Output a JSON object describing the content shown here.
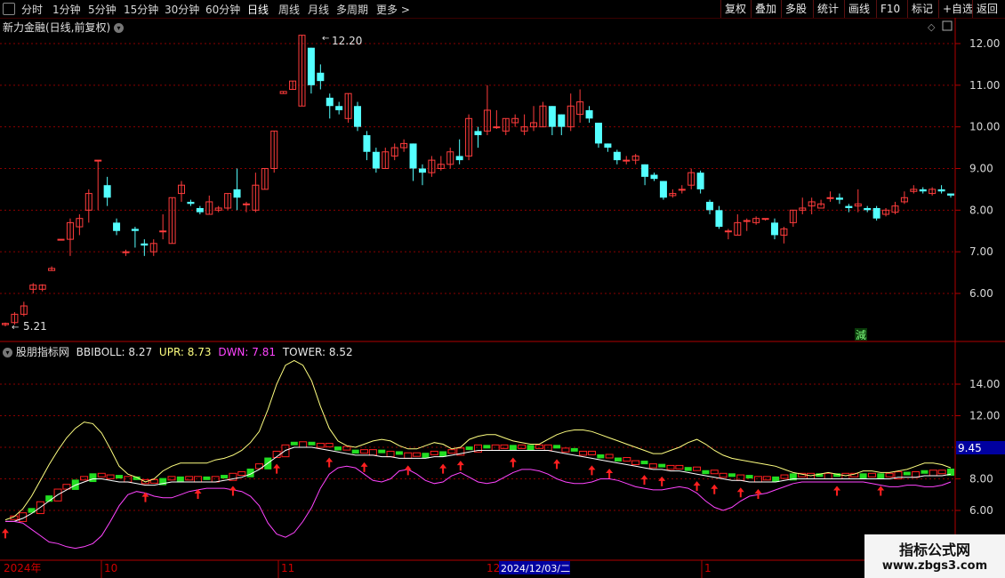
{
  "toolbar": {
    "periods": [
      "分时",
      "1分钟",
      "5分钟",
      "15分钟",
      "30分钟",
      "60分钟",
      "日线",
      "周线",
      "月线",
      "多周期",
      "更多 >"
    ],
    "active_period": "日线",
    "right_buttons": [
      "复权",
      "叠加",
      "多股",
      "统计",
      "画线",
      "F10",
      "标记",
      "+自选",
      "返回"
    ]
  },
  "chart_title": "新力金融(日线,前复权)",
  "price_axis_labels": [
    "12.00",
    "11.00",
    "10.00",
    "9.00",
    "8.00",
    "7.00",
    "6.00"
  ],
  "indicator": {
    "name": "股朋指标网",
    "bbiboll_label": "BBIBOLL: 8.27",
    "upr_label": "UPR: 8.73",
    "dwn_label": "DWN: 7.81",
    "tower_label": "TOWER: 8.52",
    "axis_labels": [
      "14.00",
      "12.00",
      "10.00",
      "8.00",
      "6.00"
    ],
    "current_value": "9.45"
  },
  "annotations": {
    "high": "12.20",
    "low": "5.21",
    "reduce_marker": "減"
  },
  "date_axis": {
    "labels": [
      "2024年",
      "10",
      "11",
      "12",
      "1"
    ],
    "cursor_date": "2024/12/03/二"
  },
  "watermark": {
    "line1": "指标公式网",
    "line2": "www.zbgs3.com"
  },
  "colors": {
    "up": "#ff3c3c",
    "down": "#54ffff",
    "upr_line": "#ffff80",
    "dwn_line": "#ff44ff",
    "mid_line": "#ffffff",
    "grid": "#8a0000",
    "bar_green": "#22dd22",
    "arrow": "#ff2020"
  },
  "chart_data": [
    {
      "type": "candlestick",
      "title": "新力金融(日线,前复权)",
      "ylim": [
        5.2,
        12.3
      ],
      "y_ticks": [
        12,
        11,
        10,
        9,
        8,
        7,
        6
      ],
      "x_labels": [
        "2024年",
        "10",
        "11",
        "12",
        "1"
      ],
      "candles": [
        [
          5.25,
          5.28,
          5.21,
          5.3
        ],
        [
          5.3,
          5.5,
          5.25,
          5.55
        ],
        [
          5.5,
          5.7,
          5.45,
          5.8
        ],
        [
          6.1,
          6.2,
          6.0,
          6.25
        ],
        [
          6.1,
          6.2,
          6.05,
          6.22
        ],
        [
          6.55,
          6.6,
          6.55,
          6.65
        ],
        [
          7.3,
          7.3,
          7.28,
          7.3
        ],
        [
          7.3,
          7.7,
          6.9,
          7.8
        ],
        [
          7.6,
          7.8,
          7.4,
          7.9
        ],
        [
          8.0,
          8.4,
          7.7,
          8.5
        ],
        [
          9.2,
          9.2,
          8.0,
          9.2
        ],
        [
          8.6,
          8.3,
          8.1,
          8.8
        ],
        [
          7.7,
          7.5,
          7.4,
          7.8
        ],
        [
          7.0,
          7.0,
          6.9,
          7.05
        ],
        [
          7.55,
          7.5,
          7.1,
          7.6
        ],
        [
          7.2,
          7.15,
          6.9,
          7.3
        ],
        [
          7.0,
          7.2,
          6.9,
          7.3
        ],
        [
          7.5,
          7.5,
          7.3,
          7.9
        ],
        [
          7.2,
          8.3,
          7.2,
          8.3
        ],
        [
          8.4,
          8.6,
          8.2,
          8.7
        ],
        [
          8.2,
          8.15,
          8.1,
          8.25
        ],
        [
          8.05,
          7.95,
          7.9,
          8.1
        ],
        [
          7.9,
          8.2,
          7.9,
          8.35
        ],
        [
          8.0,
          8.05,
          7.95,
          8.1
        ],
        [
          8.05,
          8.4,
          8.0,
          8.4
        ],
        [
          8.5,
          8.3,
          8.0,
          9.0
        ],
        [
          8.15,
          8.15,
          7.95,
          8.2
        ],
        [
          8.0,
          8.6,
          7.95,
          8.9
        ],
        [
          8.5,
          9.0,
          8.5,
          9.0
        ],
        [
          9.0,
          9.9,
          8.9,
          9.9
        ],
        [
          10.8,
          10.85,
          10.8,
          10.85
        ],
        [
          10.9,
          11.1,
          10.9,
          11.1
        ],
        [
          10.5,
          12.2,
          10.5,
          12.2
        ],
        [
          11.9,
          11.0,
          10.8,
          11.9
        ],
        [
          11.3,
          11.1,
          10.9,
          11.5
        ],
        [
          10.7,
          10.5,
          10.2,
          10.8
        ],
        [
          10.5,
          10.4,
          10.3,
          10.6
        ],
        [
          10.2,
          10.8,
          10.1,
          10.8
        ],
        [
          10.5,
          10.0,
          9.9,
          10.6
        ],
        [
          9.8,
          9.4,
          9.2,
          9.9
        ],
        [
          9.4,
          9.0,
          8.9,
          9.5
        ],
        [
          9.0,
          9.4,
          9.0,
          9.5
        ],
        [
          9.3,
          9.5,
          9.2,
          9.6
        ],
        [
          9.5,
          9.6,
          9.4,
          9.7
        ],
        [
          9.6,
          9.0,
          8.7,
          9.6
        ],
        [
          9.0,
          8.9,
          8.6,
          9.1
        ],
        [
          8.9,
          9.2,
          8.8,
          9.3
        ],
        [
          9.0,
          9.1,
          8.95,
          9.3
        ],
        [
          9.1,
          9.4,
          9.0,
          9.5
        ],
        [
          9.3,
          9.2,
          9.1,
          9.7
        ],
        [
          9.3,
          10.2,
          9.2,
          10.3
        ],
        [
          9.9,
          9.8,
          9.5,
          10.0
        ],
        [
          9.9,
          10.4,
          9.8,
          11.0
        ],
        [
          10.0,
          10.0,
          9.95,
          10.4
        ],
        [
          9.9,
          10.2,
          9.8,
          10.2
        ],
        [
          10.1,
          10.2,
          10.0,
          10.3
        ],
        [
          9.9,
          10.0,
          9.8,
          10.3
        ],
        [
          10.0,
          10.1,
          9.9,
          10.5
        ],
        [
          10.0,
          10.5,
          10.0,
          10.6
        ],
        [
          10.5,
          10.0,
          9.8,
          10.5
        ],
        [
          10.3,
          10.0,
          9.8,
          10.3
        ],
        [
          10.0,
          10.5,
          9.9,
          10.8
        ],
        [
          10.3,
          10.6,
          10.1,
          10.9
        ],
        [
          10.4,
          10.2,
          10.1,
          10.5
        ],
        [
          10.1,
          9.6,
          9.5,
          10.1
        ],
        [
          9.6,
          9.5,
          9.4,
          9.6
        ],
        [
          9.4,
          9.2,
          9.1,
          9.45
        ],
        [
          9.2,
          9.2,
          9.1,
          9.3
        ],
        [
          9.2,
          9.3,
          9.1,
          9.35
        ],
        [
          9.1,
          8.8,
          8.6,
          9.1
        ],
        [
          8.85,
          8.75,
          8.7,
          8.9
        ],
        [
          8.7,
          8.3,
          8.25,
          8.7
        ],
        [
          8.35,
          8.4,
          8.3,
          8.5
        ],
        [
          8.5,
          8.5,
          8.4,
          8.6
        ],
        [
          8.6,
          8.9,
          8.5,
          9.0
        ],
        [
          8.9,
          8.5,
          8.4,
          8.95
        ],
        [
          8.2,
          8.0,
          7.9,
          8.25
        ],
        [
          8.0,
          7.6,
          7.55,
          8.1
        ],
        [
          7.5,
          7.5,
          7.3,
          7.55
        ],
        [
          7.4,
          7.7,
          7.4,
          7.9
        ],
        [
          7.75,
          7.75,
          7.5,
          7.8
        ],
        [
          7.7,
          7.8,
          7.65,
          7.85
        ],
        [
          7.8,
          7.8,
          7.75,
          7.8
        ],
        [
          7.7,
          7.4,
          7.3,
          7.8
        ],
        [
          7.4,
          7.55,
          7.2,
          7.6
        ],
        [
          7.7,
          8.0,
          7.6,
          8.0
        ],
        [
          8.0,
          8.05,
          7.9,
          8.3
        ],
        [
          8.1,
          8.2,
          7.9,
          8.3
        ],
        [
          8.05,
          8.15,
          8.1,
          8.25
        ],
        [
          8.3,
          8.3,
          8.2,
          8.45
        ],
        [
          8.3,
          8.25,
          8.15,
          8.4
        ],
        [
          8.1,
          8.05,
          7.95,
          8.15
        ],
        [
          8.1,
          8.15,
          7.95,
          8.5
        ],
        [
          8.05,
          8.0,
          7.95,
          8.1
        ],
        [
          8.05,
          7.8,
          7.75,
          8.1
        ],
        [
          7.9,
          8.0,
          7.85,
          8.05
        ],
        [
          7.95,
          8.1,
          7.9,
          8.2
        ],
        [
          8.2,
          8.3,
          8.15,
          8.45
        ],
        [
          8.45,
          8.5,
          8.4,
          8.6
        ],
        [
          8.5,
          8.45,
          8.4,
          8.55
        ],
        [
          8.4,
          8.5,
          8.35,
          8.55
        ],
        [
          8.5,
          8.45,
          8.4,
          8.6
        ],
        [
          8.4,
          8.35,
          8.3,
          8.4
        ]
      ]
    },
    {
      "type": "line",
      "title": "股朋指标网",
      "ylim": [
        3.5,
        16.5
      ],
      "y_ticks": [
        14,
        12,
        10,
        8,
        6
      ],
      "series": [
        {
          "name": "UPR",
          "values": [
            5.4,
            5.6,
            6.1,
            6.9,
            7.9,
            8.9,
            9.8,
            10.6,
            11.2,
            11.6,
            11.5,
            10.9,
            9.9,
            8.8,
            8.3,
            8.1,
            7.8,
            8.0,
            8.5,
            8.8,
            9.0,
            9.0,
            9.0,
            9.0,
            9.2,
            9.3,
            9.5,
            9.8,
            10.3,
            11.0,
            12.4,
            14.0,
            15.2,
            15.5,
            15.2,
            14.2,
            12.6,
            11.2,
            10.4,
            10.1,
            10.0,
            10.2,
            10.4,
            10.5,
            10.4,
            10.1,
            9.9,
            9.9,
            10.1,
            10.3,
            10.2,
            9.9,
            10.0,
            10.5,
            10.7,
            10.8,
            10.8,
            10.6,
            10.4,
            10.3,
            10.2,
            10.2,
            10.5,
            10.8,
            11.0,
            11.1,
            11.1,
            11.0,
            10.8,
            10.6,
            10.4,
            10.2,
            10.0,
            9.8,
            9.6,
            9.6,
            9.8,
            10.0,
            10.3,
            10.5,
            10.2,
            9.8,
            9.5,
            9.3,
            9.2,
            9.1,
            9.0,
            8.9,
            8.8,
            8.6,
            8.4,
            8.3,
            8.2,
            8.3,
            8.4,
            8.3,
            8.2,
            8.3,
            8.5,
            8.5,
            8.4,
            8.4,
            8.5,
            8.6,
            8.8,
            9.0,
            9.0,
            8.9,
            8.7
          ]
        },
        {
          "name": "BBIBOLL",
          "values": [
            5.3,
            5.3,
            5.5,
            5.8,
            6.2,
            6.6,
            7.0,
            7.3,
            7.6,
            7.8,
            8.0,
            8.0,
            7.9,
            7.8,
            7.8,
            7.7,
            7.6,
            7.6,
            7.7,
            7.8,
            7.8,
            7.8,
            7.8,
            7.8,
            7.8,
            7.9,
            8.0,
            8.1,
            8.3,
            8.6,
            9.0,
            9.4,
            9.8,
            10.0,
            10.0,
            10.0,
            9.9,
            9.8,
            9.7,
            9.6,
            9.5,
            9.5,
            9.5,
            9.4,
            9.4,
            9.3,
            9.3,
            9.3,
            9.3,
            9.4,
            9.4,
            9.5,
            9.6,
            9.7,
            9.8,
            9.8,
            9.8,
            9.8,
            9.8,
            9.8,
            9.8,
            9.8,
            9.8,
            9.7,
            9.6,
            9.5,
            9.4,
            9.3,
            9.2,
            9.1,
            9.0,
            8.9,
            8.8,
            8.7,
            8.6,
            8.6,
            8.5,
            8.5,
            8.4,
            8.3,
            8.2,
            8.1,
            8.0,
            7.9,
            7.9,
            7.8,
            7.8,
            7.8,
            7.8,
            7.9,
            8.0,
            8.0,
            8.0,
            8.0,
            8.0,
            8.0,
            8.0,
            8.0,
            8.0,
            8.0,
            8.0,
            8.0,
            8.1,
            8.1,
            8.1,
            8.2,
            8.2,
            8.2,
            8.3
          ]
        },
        {
          "name": "DWN",
          "values": [
            5.3,
            5.3,
            5.2,
            4.8,
            4.4,
            4.0,
            3.9,
            3.7,
            3.6,
            3.7,
            3.9,
            4.4,
            5.3,
            6.3,
            7.0,
            7.2,
            7.1,
            6.9,
            6.8,
            6.8,
            7.0,
            7.2,
            7.3,
            7.4,
            7.4,
            7.4,
            7.3,
            7.2,
            6.9,
            6.3,
            5.2,
            4.5,
            4.3,
            4.6,
            5.3,
            6.2,
            7.4,
            8.3,
            8.7,
            8.8,
            8.7,
            8.3,
            7.9,
            7.8,
            8.0,
            8.5,
            8.6,
            8.3,
            7.9,
            7.7,
            7.8,
            8.2,
            8.4,
            8.1,
            7.8,
            7.7,
            7.8,
            8.1,
            8.4,
            8.6,
            8.6,
            8.5,
            8.3,
            8.0,
            7.8,
            7.7,
            7.7,
            7.8,
            8.0,
            8.0,
            7.9,
            7.7,
            7.5,
            7.4,
            7.3,
            7.3,
            7.4,
            7.5,
            7.4,
            7.1,
            6.6,
            6.2,
            6.0,
            6.2,
            6.6,
            6.9,
            7.0,
            7.1,
            7.3,
            7.5,
            7.7,
            7.8,
            7.8,
            7.8,
            7.8,
            7.8,
            7.8,
            7.8,
            7.8,
            7.7,
            7.6,
            7.5,
            7.5,
            7.6,
            7.6,
            7.5,
            7.5,
            7.6,
            7.8
          ]
        }
      ]
    }
  ]
}
